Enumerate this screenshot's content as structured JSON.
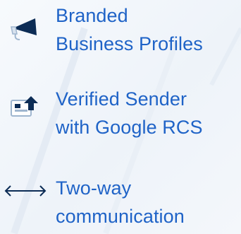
{
  "features": [
    {
      "icon": "megaphone-icon",
      "lines": [
        "Branded",
        "Business Profiles"
      ]
    },
    {
      "icon": "verified-badge-icon",
      "lines": [
        "Verified Sender",
        "with Google RCS"
      ]
    },
    {
      "icon": "two-way-arrow-icon",
      "lines": [
        "Two-way",
        "communication"
      ]
    }
  ],
  "colors": {
    "text": "#1f63c7",
    "icon_dark": "#0c2c55",
    "icon_light": "#9fb6cf"
  }
}
